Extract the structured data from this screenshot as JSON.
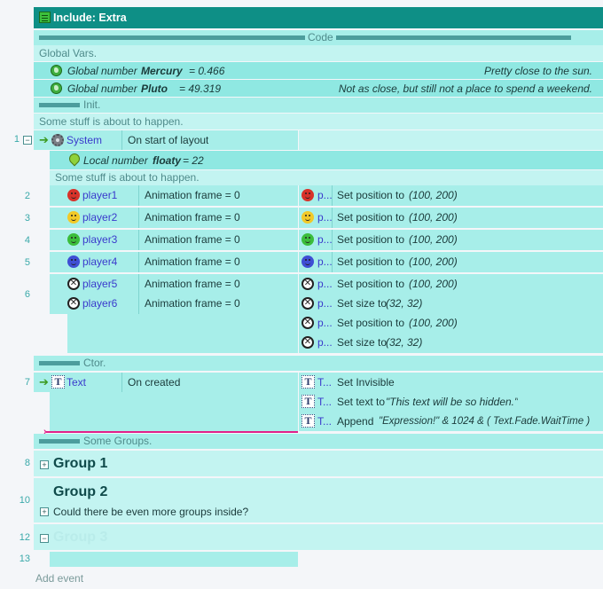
{
  "header": {
    "title": "Include: Extra"
  },
  "code_section": {
    "label": "Code"
  },
  "global_vars": {
    "comment": "Global Vars.",
    "vars": [
      {
        "kind": "Global number",
        "name": "Mercury",
        "value": "= 0.466",
        "comment": "Pretty close to the sun."
      },
      {
        "kind": "Global number",
        "name": "Pluto",
        "value": "= 49.319",
        "comment": "Not as close, but still not a place to spend a weekend."
      }
    ]
  },
  "init": {
    "label": "Init.",
    "comment": "Some stuff is about to happen.",
    "event1": {
      "line": "1",
      "object": "System",
      "condition": "On start of layout",
      "local_var": {
        "kind": "Local number",
        "name": "floaty",
        "value": "= 22"
      },
      "comment": "Some stuff is about to happen.",
      "subevents": [
        {
          "line": "2",
          "object": "player1",
          "condition": "Animation frame = 0",
          "action_obj": "p...",
          "action": "Set position to ",
          "params": "(100, 200)"
        },
        {
          "line": "3",
          "object": "player2",
          "condition": "Animation frame = 0",
          "action_obj": "p...",
          "action": "Set position to ",
          "params": "(100, 200)"
        },
        {
          "line": "4",
          "object": "player3",
          "condition": "Animation frame = 0",
          "action_obj": "p...",
          "action": "Set position to ",
          "params": "(100, 200)"
        },
        {
          "line": "5",
          "object": "player4",
          "condition": "Animation frame = 0",
          "action_obj": "p...",
          "action": "Set position to ",
          "params": "(100, 200)"
        }
      ],
      "event6": {
        "line": "6",
        "conditions": [
          {
            "object": "player5",
            "condition": "Animation frame = 0"
          },
          {
            "object": "player6",
            "condition": "Animation frame = 0"
          }
        ],
        "actions": [
          {
            "obj": "p...",
            "action": "Set position to ",
            "params": "(100, 200)"
          },
          {
            "obj": "p...",
            "action": "Set size to ",
            "params": "(32, 32)"
          },
          {
            "obj": "p...",
            "action": "Set position to ",
            "params": "(100, 200)"
          },
          {
            "obj": "p...",
            "action": "Set size to ",
            "params": "(32, 32)"
          }
        ]
      }
    }
  },
  "ctor": {
    "label": "Ctor.",
    "event7": {
      "line": "7",
      "object": "Text",
      "condition": "On created",
      "actions": [
        {
          "obj": "T...",
          "action": "Set Invisible",
          "params": ""
        },
        {
          "obj": "T...",
          "action": "Set text to ",
          "params": "\"This text will be so hidden.\""
        },
        {
          "obj": "T...",
          "action": "Append ",
          "params": "\"Expression!\" & 1024 & ( Text.Fade.WaitTime )"
        }
      ]
    }
  },
  "groups": {
    "label": "Some Groups.",
    "items": [
      {
        "line": "8",
        "title": "Group 1",
        "desc": ""
      },
      {
        "line": "10",
        "title": "Group 2",
        "desc": "Could there be even more groups inside?"
      },
      {
        "line": "12",
        "title": "Group 3",
        "desc": ""
      }
    ]
  },
  "line13": {
    "line": "13"
  },
  "footer": {
    "add_event": "Add event"
  },
  "colors": {
    "header": "#0e8f86",
    "row": "#a7eee9",
    "selection": "#e0208a"
  },
  "icons": [
    "sheet-icon",
    "globe-icon",
    "gear-icon",
    "arrow-icon",
    "pin-icon",
    "face-icon",
    "x-face-icon",
    "text-object-icon"
  ]
}
